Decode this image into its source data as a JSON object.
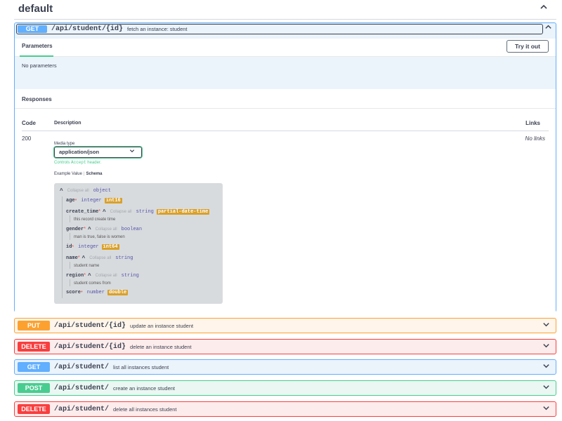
{
  "section": {
    "title": "default",
    "chevron": "chevron-up-icon"
  },
  "expanded_op": {
    "method": "GET",
    "path": "/api/student/{id}",
    "summary": "fetch an instance: student",
    "tab_parameters": "Parameters",
    "try_it_out": "Try it out",
    "no_parameters": "No parameters",
    "responses_title": "Responses",
    "col_code": "Code",
    "col_description": "Description",
    "col_links": "Links",
    "response_code": "200",
    "no_links": "No links",
    "media_type_label": "Media type",
    "media_type_value": "application/json",
    "controls_pre": "Controls",
    "controls_mono": "Accept",
    "controls_post": "header.",
    "tab_example": "Example Value",
    "tab_schema": "Schema",
    "schema": {
      "collapse_all": "Collapse all",
      "root_type": "object",
      "props": [
        {
          "name": "age",
          "type": "integer",
          "format": "int16"
        },
        {
          "name": "create_time",
          "type": "string",
          "format": "partial-date-time",
          "desc": "this record create time"
        },
        {
          "name": "gender",
          "type": "boolean",
          "desc": "man is true, false is women"
        },
        {
          "name": "id",
          "type": "integer",
          "format": "int64"
        },
        {
          "name": "name",
          "type": "string",
          "desc": "student name"
        },
        {
          "name": "region",
          "type": "string",
          "desc": "student comes from"
        },
        {
          "name": "score",
          "type": "number",
          "format": "double"
        }
      ]
    }
  },
  "ops": [
    {
      "method": "PUT",
      "path": "/api/student/{id}",
      "summary": "update an instance student"
    },
    {
      "method": "DELETE",
      "path": "/api/student/{id}",
      "summary": "delete an instance student"
    },
    {
      "method": "GET",
      "path": "/api/student/",
      "summary": "list all instances student"
    },
    {
      "method": "POST",
      "path": "/api/student/",
      "summary": "create an instance student"
    },
    {
      "method": "DELETE",
      "path": "/api/student/",
      "summary": "delete all instances student"
    }
  ]
}
